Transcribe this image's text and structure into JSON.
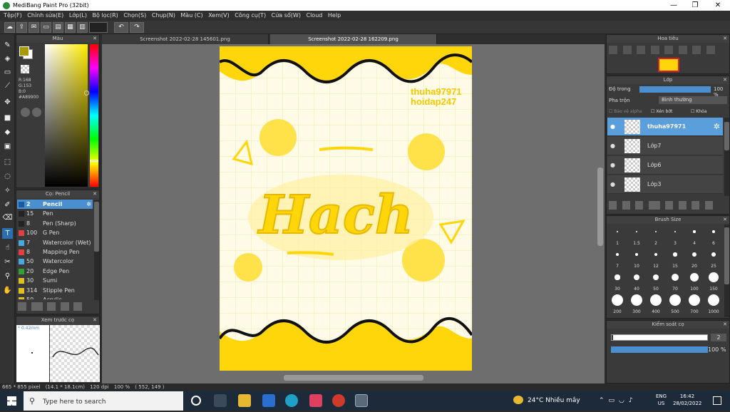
{
  "window": {
    "title": "MediBang Paint Pro (32bit)",
    "controls": [
      "—",
      "❐",
      "✕"
    ]
  },
  "menu": [
    "Tệp(F)",
    "Chỉnh sửa(E)",
    "Lớp(L)",
    "Bộ lọc(R)",
    "Chọn(S)",
    "Chụp(N)",
    "Màu (C)",
    "Xem(V)",
    "Công cụ(T)",
    "Cửa sổ(W)",
    "Cloud",
    "Help"
  ],
  "toolbar": {
    "undo": "↶",
    "redo": "↷"
  },
  "color_panel": {
    "title": "Màu",
    "r": "R:168",
    "g": "G:153",
    "b": "B:0",
    "hex": "#A89900",
    "primary_color": "#a89900"
  },
  "brush_panel": {
    "title": "Cọ: Pencil",
    "brushes": [
      {
        "size": "2",
        "name": "Pencil",
        "color": "#1e5aa0",
        "selected": true
      },
      {
        "size": "15",
        "name": "Pen",
        "color": "#222222"
      },
      {
        "size": "8",
        "name": "Pen (Sharp)",
        "color": "#222222"
      },
      {
        "size": "100",
        "name": "G Pen",
        "color": "#e04040"
      },
      {
        "size": "7",
        "name": "Watercolor (Wet)",
        "color": "#4aa8e0"
      },
      {
        "size": "8",
        "name": "Mapping Pen",
        "color": "#e04040"
      },
      {
        "size": "50",
        "name": "Watercolor",
        "color": "#4aa8e0"
      },
      {
        "size": "20",
        "name": "Edge Pen",
        "color": "#30a030"
      },
      {
        "size": "30",
        "name": "Sumi",
        "color": "#e0c020"
      },
      {
        "size": "314",
        "name": "Stipple Pen",
        "color": "#e0c020"
      },
      {
        "size": "50",
        "name": "Acrylic",
        "color": "#e0c020"
      }
    ]
  },
  "preview_panel": {
    "title": "Xem trước cọ",
    "size": "0.42mm"
  },
  "tabs": [
    "Screenshot 2022-02-28 145601.png",
    "Screenshot 2022-02-28 162209.png"
  ],
  "artwork": {
    "watermark1": "thuha97971",
    "watermark2": "hoidap247",
    "main_word": "Hach",
    "paper_color": "#fffbe6",
    "accent_color": "#ffd60a",
    "line_color": "#111111"
  },
  "navigator": {
    "title": "Hoa tiêu"
  },
  "layer_panel": {
    "title": "Lớp",
    "opacity_label": "Độ trong",
    "opacity_value": "100 %",
    "opacity_fraction": 1.0,
    "blend_label": "Pha trộn",
    "blend_value": "Bình thường",
    "alpha_label": "Bảo vệ alpha",
    "clip_label": "Xén bớt",
    "lock_label": "Khóa",
    "layers": [
      {
        "name": "thuha97971",
        "selected": true
      },
      {
        "name": "Lớp7",
        "selected": false
      },
      {
        "name": "Lớp6",
        "selected": false
      },
      {
        "name": "Lớp3",
        "selected": false
      }
    ]
  },
  "brush_size_panel": {
    "title": "Brush Size",
    "sizes": [
      "1",
      "1.5",
      "2",
      "3",
      "4",
      "6",
      "7",
      "10",
      "12",
      "15",
      "20",
      "25",
      "30",
      "40",
      "50",
      "70",
      "100",
      "150",
      "200",
      "300",
      "400",
      "500",
      "700",
      "1000"
    ]
  },
  "brush_control": {
    "title": "Kiểm soát cọ",
    "size_value": "2",
    "opacity_value": "100 %",
    "opacity_fraction": 1.0
  },
  "status": {
    "dims": "665 * 855 pixel",
    "cm": "(14.1 * 18.1cm)",
    "dpi": "120 dpi",
    "zoom": "100 %",
    "coords": "( 552, 149 )"
  },
  "taskbar": {
    "search_placeholder": "Type here to search",
    "weather": "24°C  Nhiều mây",
    "lang1": "ENG",
    "lang2": "US",
    "time": "16:42",
    "date": "28/02/2022"
  }
}
